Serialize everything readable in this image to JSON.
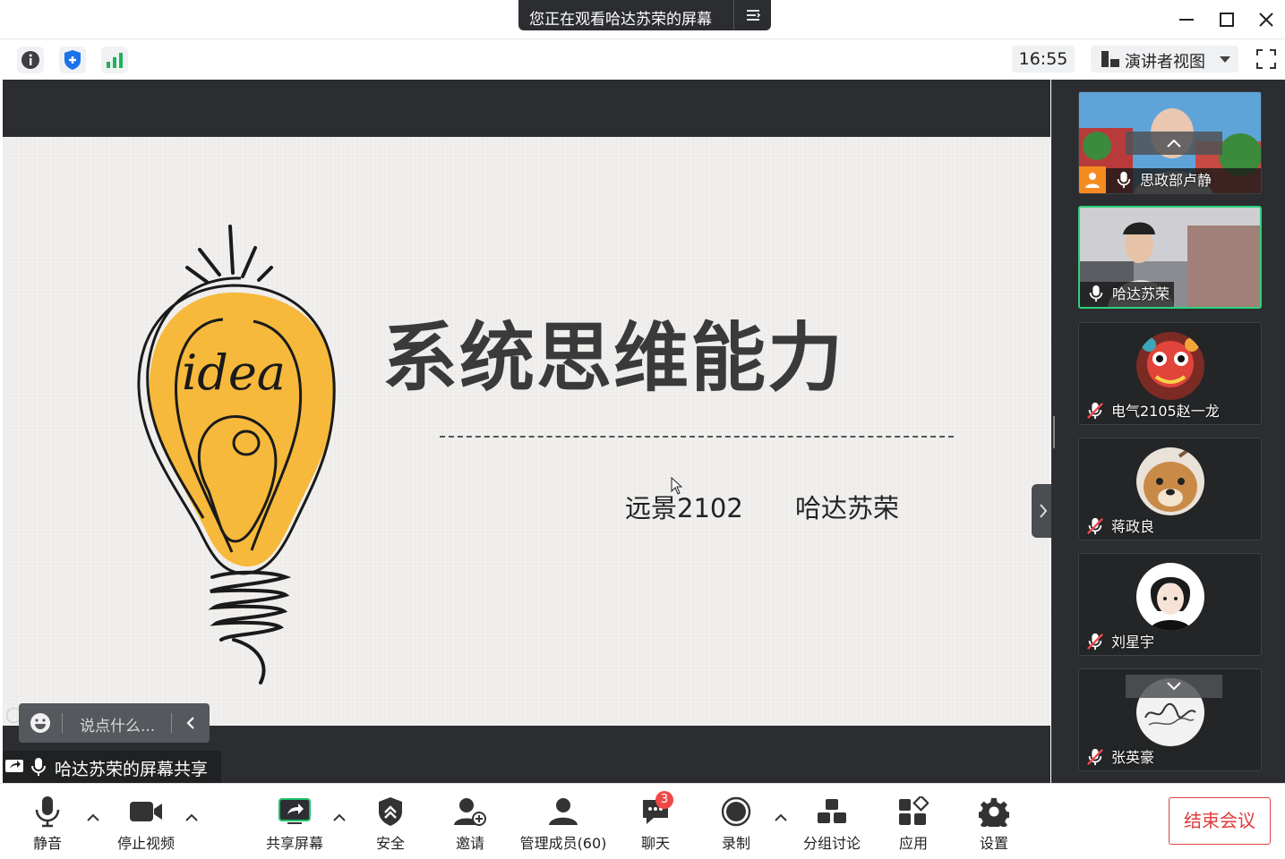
{
  "title_bar": {
    "share_banner_text": "您正在观看哈达苏荣的屏幕",
    "banner_menu_icon": "menu-lines-icon",
    "window_controls": [
      "minimize-icon",
      "maximize-icon",
      "close-icon"
    ]
  },
  "info_bar": {
    "icons": [
      "info-icon",
      "shield-icon",
      "signal-bars-icon"
    ],
    "clock": "16:55",
    "view_mode": "演讲者视图",
    "fullscreen_icon": "fullscreen-icon"
  },
  "slide": {
    "title": "系统思维能力",
    "class_name": "远景2102",
    "author": "哈达苏荣",
    "illustration_word": "idea"
  },
  "chat": {
    "placeholder": "说点什么..."
  },
  "sharer_label": "哈达苏荣的屏幕共享",
  "participants": [
    {
      "name": "思政部卢静",
      "muted": false,
      "video": true,
      "active": false
    },
    {
      "name": "哈达苏荣",
      "muted": false,
      "video": true,
      "active": true
    },
    {
      "name": "电气2105赵一龙",
      "muted": true,
      "video": false,
      "active": false
    },
    {
      "name": "蒋政良",
      "muted": true,
      "video": false,
      "active": false
    },
    {
      "name": "刘星宇",
      "muted": true,
      "video": false,
      "active": false
    },
    {
      "name": "张英豪",
      "muted": true,
      "video": false,
      "active": false
    }
  ],
  "toolbar": {
    "mute": "静音",
    "stop_video": "停止视频",
    "share_screen": "共享屏幕",
    "security": "安全",
    "invite": "邀请",
    "manage_members": "管理成员(60)",
    "chat": "聊天",
    "chat_badge": "3",
    "record": "录制",
    "breakout": "分组讨论",
    "apps": "应用",
    "settings": "设置",
    "end_meeting": "结束会议"
  },
  "colors": {
    "accent_green": "#2bd27a",
    "end_red": "#e03a3a",
    "bulb_yellow": "#f6b93b",
    "dark_bg": "#2b2d30"
  }
}
